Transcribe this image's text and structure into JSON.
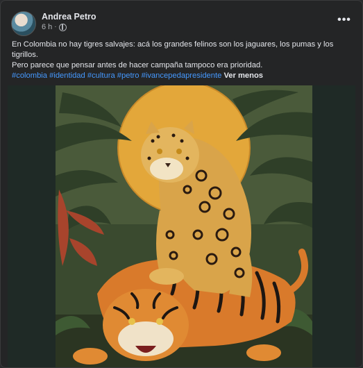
{
  "post": {
    "author": "Andrea Petro",
    "time": "6 h",
    "separator": "·",
    "privacy_icon": "globe-icon",
    "more_icon": "more-options-icon",
    "text_line1": "En Colombia no hay tigres salvajes: acá los grandes felinos son los jaguares, los pumas y los tigrillos.",
    "text_line2": "Pero parece que pensar antes de hacer campaña tampoco era prioridad.",
    "hashtags": [
      "#colombia",
      "#identidad",
      "#cultura",
      "#petro",
      "#ivancepedapresidente"
    ],
    "see_less": "Ver menos"
  },
  "colors": {
    "background": "#242526",
    "text": "#e4e6eb",
    "secondary_text": "#b0b3b8",
    "link": "#4599ff"
  }
}
